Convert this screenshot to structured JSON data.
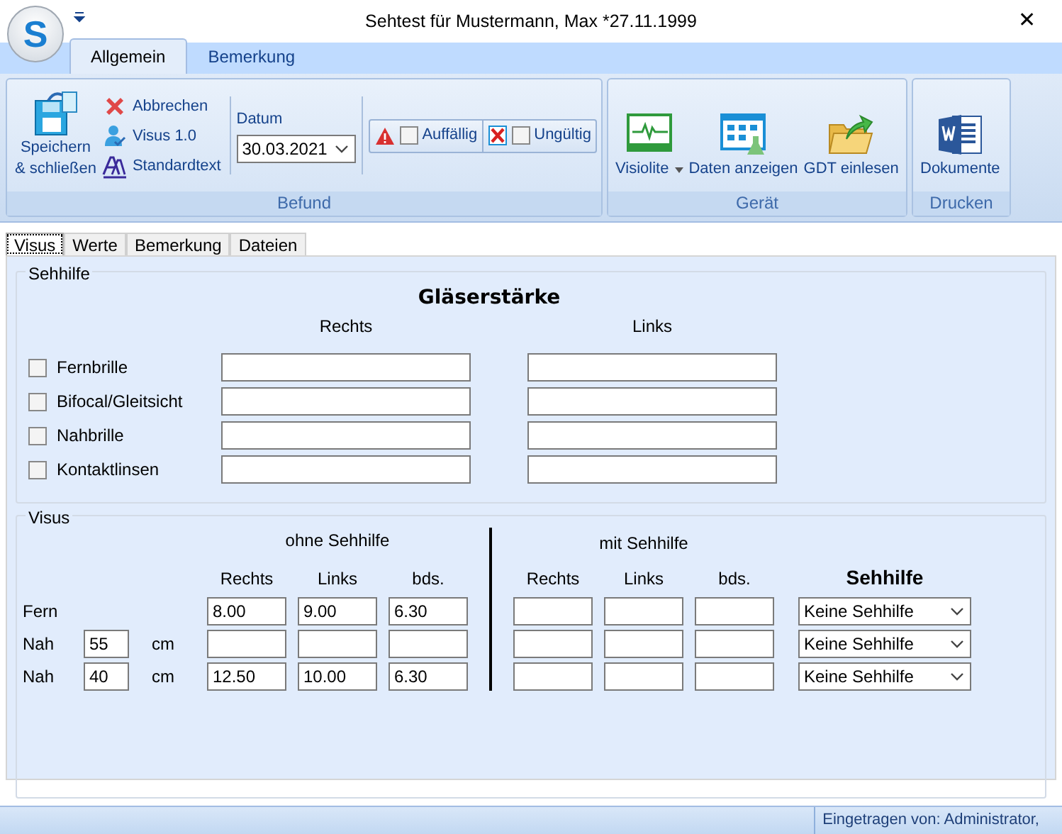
{
  "app_logo": "S",
  "window": {
    "title": "Sehtest für Mustermann, Max *27.11.1999",
    "close": "✕"
  },
  "ribbon_tabs": [
    {
      "label": "Allgemein",
      "selected": true
    },
    {
      "label": "Bemerkung",
      "selected": false
    }
  ],
  "ribbon_groups": [
    {
      "label": "Befund",
      "items": [
        {
          "kind": "large",
          "label": "Speichern & schließen"
        },
        {
          "kind": "small",
          "label": "Abbrechen"
        },
        {
          "kind": "small",
          "label": "Visus 1.0"
        },
        {
          "kind": "small",
          "label": "Standardtext"
        },
        {
          "kind": "date",
          "label": "Datum",
          "value": "30.03.2021"
        },
        {
          "kind": "flag",
          "label": "Auffällig",
          "checked": false
        },
        {
          "kind": "flag",
          "label": "Ungültig",
          "checked": false
        }
      ]
    },
    {
      "label": "Gerät",
      "items": [
        {
          "kind": "large",
          "label": "Visiolite",
          "dropdown": true
        },
        {
          "kind": "large",
          "label": "Daten anzeigen",
          "dropdown": false
        },
        {
          "kind": "large",
          "label": "GDT einlesen",
          "dropdown": false
        }
      ]
    },
    {
      "label": "Drucken",
      "items": [
        {
          "kind": "large",
          "label": "Dokumente",
          "dropdown": false
        }
      ]
    }
  ],
  "form_tabs": [
    {
      "label": "Visus",
      "selected": true
    },
    {
      "label": "Werte",
      "selected": false
    },
    {
      "label": "Bemerkung",
      "selected": false
    },
    {
      "label": "Dateien",
      "selected": false
    }
  ],
  "sehhilfe": {
    "title": "Sehhilfe",
    "heading": "Gläserstärke",
    "columns": [
      "Rechts",
      "Links"
    ],
    "rows": [
      {
        "label": "Fernbrille",
        "checked": false
      },
      {
        "label": "Bifocal/Gleitsicht",
        "checked": false
      },
      {
        "label": "Nahbrille",
        "checked": false
      },
      {
        "label": "Kontaktlinsen",
        "checked": false
      }
    ]
  },
  "visus": {
    "title": "Visus",
    "ohne_label": "ohne Sehhilfe",
    "mit_label": "mit Sehhilfe",
    "sehhilfe_label": "Sehhilfe",
    "ohne_columns": [
      "Rechts",
      "Links",
      "bds."
    ],
    "mit_columns": [
      "Rechts",
      "Links",
      "bds."
    ],
    "rows": [
      {
        "label": "Fern",
        "ohne": [
          "8.00",
          "9.00",
          "6.30"
        ],
        "sehhilfe": "Keine Sehhilfe"
      },
      {
        "label": "Nah",
        "distance": "55",
        "unit": "cm",
        "sehhilfe": "Keine Sehhilfe"
      },
      {
        "label": "Nah",
        "distance": "40",
        "unit": "cm",
        "ohne": [
          "12.50",
          "10.00",
          "6.30"
        ],
        "sehhilfe": "Keine Sehhilfe"
      }
    ]
  },
  "status_bar": {
    "text": "Eingetragen von: Administrator,"
  }
}
